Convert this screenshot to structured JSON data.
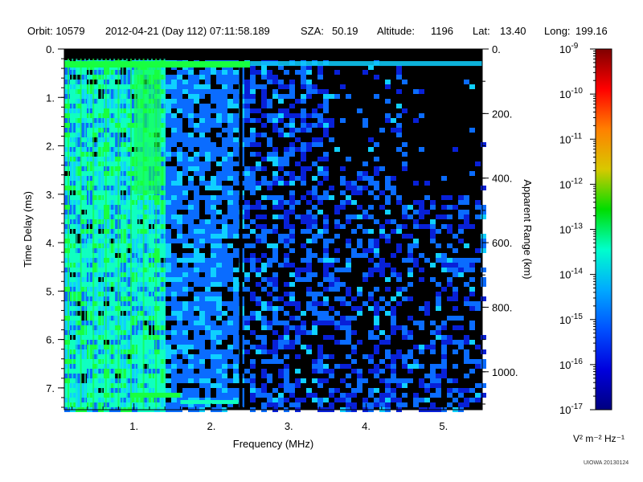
{
  "header": {
    "orbit": "Orbit: 10579",
    "datetime": "2012-04-21 (Day 112) 07:11:58.189",
    "sza_label": "SZA:",
    "sza_value": "50.19",
    "altitude_label": "Altitude:",
    "altitude_value": "1196",
    "lat_label": "Lat:",
    "lat_value": "13.40",
    "long_label": "Long:",
    "long_value": "199.16"
  },
  "chart_data": {
    "type": "heatmap",
    "xlabel": "Frequency (MHz)",
    "ylabel": "Time Delay (ms)",
    "y2label": "Apparent Range (km)",
    "xlim": [
      0.1,
      5.5
    ],
    "ylim": [
      0,
      7.45
    ],
    "y2lim": [
      0,
      1117.5
    ],
    "x_ticks": [
      {
        "value": 1,
        "label": "1."
      },
      {
        "value": 2,
        "label": "2."
      },
      {
        "value": 3,
        "label": "3."
      },
      {
        "value": 4,
        "label": "4."
      },
      {
        "value": 5,
        "label": "5."
      }
    ],
    "y_ticks": [
      {
        "value": 0,
        "label": "0."
      },
      {
        "value": 1,
        "label": "1."
      },
      {
        "value": 2,
        "label": "2."
      },
      {
        "value": 3,
        "label": "3."
      },
      {
        "value": 4,
        "label": "4."
      },
      {
        "value": 5,
        "label": "5."
      },
      {
        "value": 6,
        "label": "6."
      },
      {
        "value": 7,
        "label": "7."
      }
    ],
    "y2_ticks": [
      {
        "value": 0,
        "label": "0."
      },
      {
        "value": 200,
        "label": "200."
      },
      {
        "value": 400,
        "label": "400."
      },
      {
        "value": 600,
        "label": "600."
      },
      {
        "value": 800,
        "label": "800."
      },
      {
        "value": 1000,
        "label": "1000."
      }
    ],
    "colorbar": {
      "scale": "log",
      "range": [
        1e-17,
        1e-09
      ],
      "ticks": [
        {
          "exponent": -9,
          "label_base": "10",
          "label_exp": "-9"
        },
        {
          "exponent": -10,
          "label_base": "10",
          "label_exp": "-10"
        },
        {
          "exponent": -11,
          "label_base": "10",
          "label_exp": "-11"
        },
        {
          "exponent": -12,
          "label_base": "10",
          "label_exp": "-12"
        },
        {
          "exponent": -13,
          "label_base": "10",
          "label_exp": "-13"
        },
        {
          "exponent": -14,
          "label_base": "10",
          "label_exp": "-14"
        },
        {
          "exponent": -15,
          "label_base": "10",
          "label_exp": "-15"
        },
        {
          "exponent": -16,
          "label_base": "10",
          "label_exp": "-16"
        },
        {
          "exponent": -17,
          "label_base": "10",
          "label_exp": "-17"
        }
      ],
      "units_text": "V² m⁻² Hz⁻¹",
      "gradient_stops": [
        "#7f0000",
        "#ff0000",
        "#ff8000",
        "#d8c800",
        "#00dd00",
        "#00ffcc",
        "#00aaff",
        "#0050ff",
        "#0000dd",
        "#000080"
      ]
    },
    "colors": {
      "background": "#000000",
      "weak": "#0820d8",
      "medium": "#0a6cff",
      "strong": "#0fd0ff",
      "stronger": "#10ffc0",
      "strongest": "#18ff40"
    }
  },
  "footer": {
    "credit": "UIOWA 20130124"
  }
}
